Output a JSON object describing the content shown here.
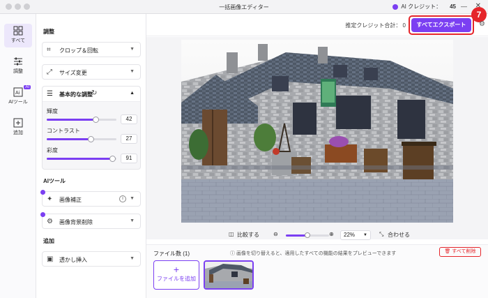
{
  "window": {
    "title": "一括画像エディター",
    "credits_label": "AI クレジット：",
    "credits_value": "45"
  },
  "rail": {
    "items": [
      {
        "label": "すべて",
        "icon": "grid-icon"
      },
      {
        "label": "調整",
        "icon": "sliders-icon"
      },
      {
        "label": "AIツール",
        "icon": "ai-icon",
        "badge": "AI"
      },
      {
        "label": "追加",
        "icon": "add-square-icon"
      }
    ]
  },
  "panel": {
    "adjust_section": "調整",
    "crop_rotate": "クロップ＆回転",
    "resize": "サイズ変更",
    "basic_adjust": "基本的な調整",
    "brightness_label": "輝度",
    "brightness_value": "42",
    "contrast_label": "コントラスト",
    "contrast_value": "27",
    "saturation_label": "彩度",
    "saturation_value": "91",
    "ai_section": "AIツール",
    "enhance": "画像補正",
    "bg_remove": "画像背景削除",
    "add_section": "追加",
    "watermark": "透かし挿入"
  },
  "slider_levels": {
    "brightness": 0.7,
    "contrast": 0.63,
    "saturation": 0.94
  },
  "topbar": {
    "estimate": "推定クレジット合計： 0",
    "export_button": "すべてエクスポート",
    "step_badge": "7"
  },
  "zoombar": {
    "compare": "比較する",
    "zoom_value": "22%",
    "fit": "合わせる"
  },
  "filebar": {
    "count": "ファイル数 (1)",
    "hint": "画像を切り替えると、適用したすべての機能の結果をプレビューできます",
    "delete_all": "すべて削除",
    "add_file": "ファイルを追加"
  },
  "colors": {
    "accent": "#7b3ff2",
    "highlight": "#e5252a"
  }
}
